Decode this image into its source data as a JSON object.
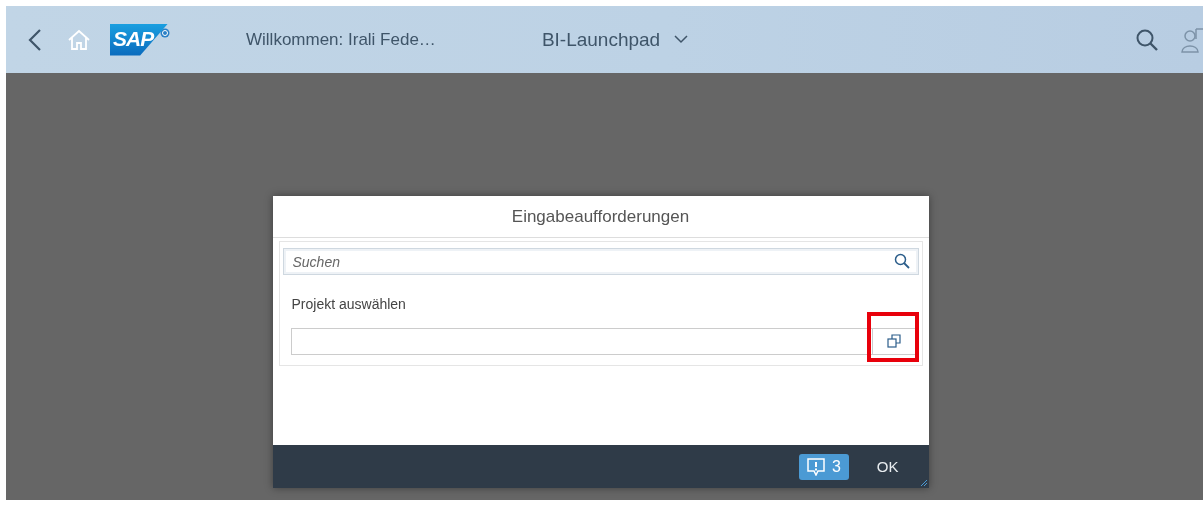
{
  "header": {
    "logo": "SAP",
    "welcome": "Willkommen: Irali Fede…",
    "app_title": "BI-Launchpad"
  },
  "dialog": {
    "title": "Eingabeaufforderungen",
    "search": {
      "placeholder": "Suchen"
    },
    "prompt_label": "Projekt auswählen",
    "highlighted": true,
    "message_count": "3",
    "ok_button": "OK"
  }
}
